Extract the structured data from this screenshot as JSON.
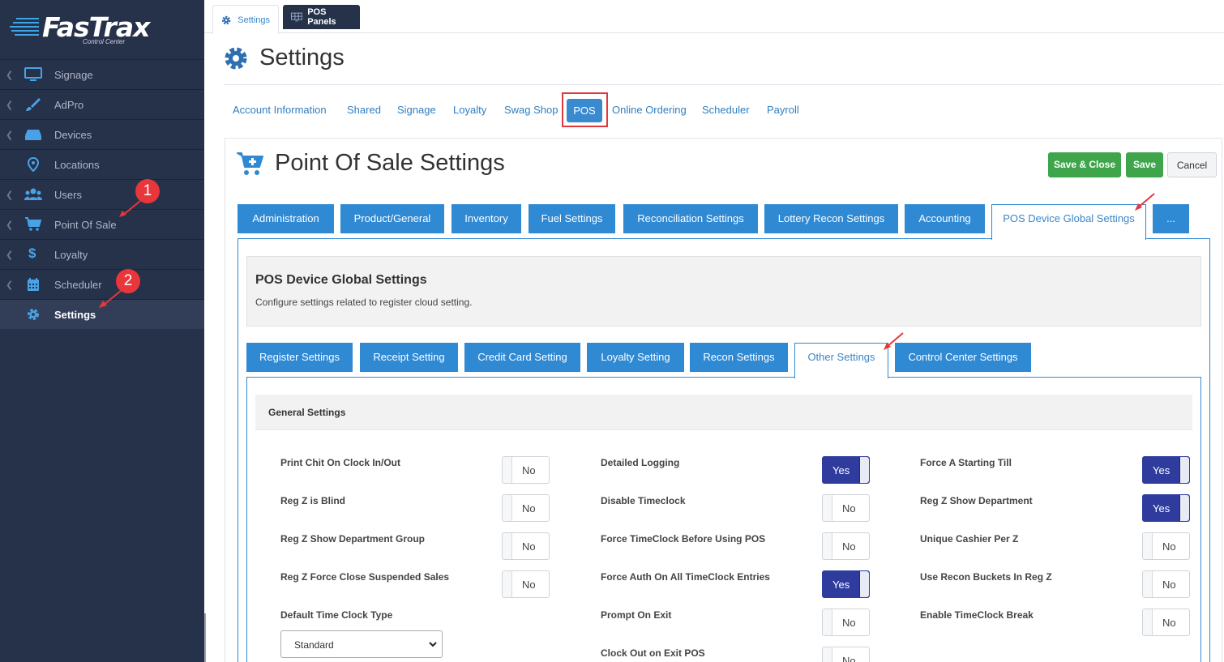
{
  "app": {
    "brand": "FasTrax",
    "brand_sub": "Control Center"
  },
  "sidebar": {
    "items": [
      {
        "label": "Signage",
        "icon": "monitor-icon"
      },
      {
        "label": "AdPro",
        "icon": "brush-icon"
      },
      {
        "label": "Devices",
        "icon": "devices-icon"
      },
      {
        "label": "Locations",
        "icon": "map-pin-icon"
      },
      {
        "label": "Users",
        "icon": "users-icon"
      },
      {
        "label": "Point Of Sale",
        "icon": "cart-icon"
      },
      {
        "label": "Loyalty",
        "icon": "dollar-icon"
      },
      {
        "label": "Scheduler",
        "icon": "calendar-icon"
      },
      {
        "label": "Settings",
        "icon": "gear-icon"
      }
    ],
    "annotations": [
      "1",
      "2"
    ]
  },
  "top_tabs": {
    "settings": "Settings",
    "pos_panels": "POS Panels"
  },
  "page": {
    "title": "Settings"
  },
  "subnav": [
    "Account Information",
    "Shared",
    "Signage",
    "Loyalty",
    "Swag Shop",
    "POS",
    "Online Ordering",
    "Scheduler",
    "Payroll"
  ],
  "pos": {
    "title": "Point Of Sale Settings",
    "buttons": {
      "save_close": "Save & Close",
      "save": "Save",
      "cancel": "Cancel"
    },
    "tabs": [
      "Administration",
      "Product/General",
      "Inventory",
      "Fuel Settings",
      "Reconciliation Settings",
      "Lottery Recon Settings",
      "Accounting",
      "POS Device Global Settings",
      "..."
    ],
    "section_title": "POS Device Global Settings",
    "section_desc": "Configure settings related to register cloud setting.",
    "subtabs": [
      "Register Settings",
      "Receipt Setting",
      "Credit Card Setting",
      "Loyalty Setting",
      "Recon Settings",
      "Other Settings",
      "Control Center Settings"
    ],
    "general_settings": "General Settings",
    "settings": [
      {
        "label": "Print Chit On Clock In/Out",
        "value": "No"
      },
      {
        "label": "Reg Z is Blind",
        "value": "No"
      },
      {
        "label": "Reg Z Show Department Group",
        "value": "No"
      },
      {
        "label": "Reg Z Force Close Suspended Sales",
        "value": "No"
      },
      {
        "label": "Default Time Clock Type",
        "value": "Standard"
      },
      {
        "label": "Detailed Logging",
        "value": "Yes"
      },
      {
        "label": "Disable Timeclock",
        "value": "No"
      },
      {
        "label": "Force TimeClock Before Using POS",
        "value": "No"
      },
      {
        "label": "Force Auth On All TimeClock Entries",
        "value": "Yes"
      },
      {
        "label": "Prompt On Exit",
        "value": "No"
      },
      {
        "label": "Clock Out on Exit POS",
        "value": "No"
      },
      {
        "label": "Force A Starting Till",
        "value": "Yes"
      },
      {
        "label": "Reg Z Show Department",
        "value": "Yes"
      },
      {
        "label": "Unique Cashier Per Z",
        "value": "No"
      },
      {
        "label": "Use Recon Buckets In Reg Z",
        "value": "No"
      },
      {
        "label": "Enable TimeClock Break",
        "value": "No"
      }
    ]
  },
  "colors": {
    "sidebar": "#26314a",
    "accent": "#2f89d3",
    "toggle_on": "#2f3c9e",
    "save": "#3ea54a",
    "annotation": "#e8363a"
  }
}
